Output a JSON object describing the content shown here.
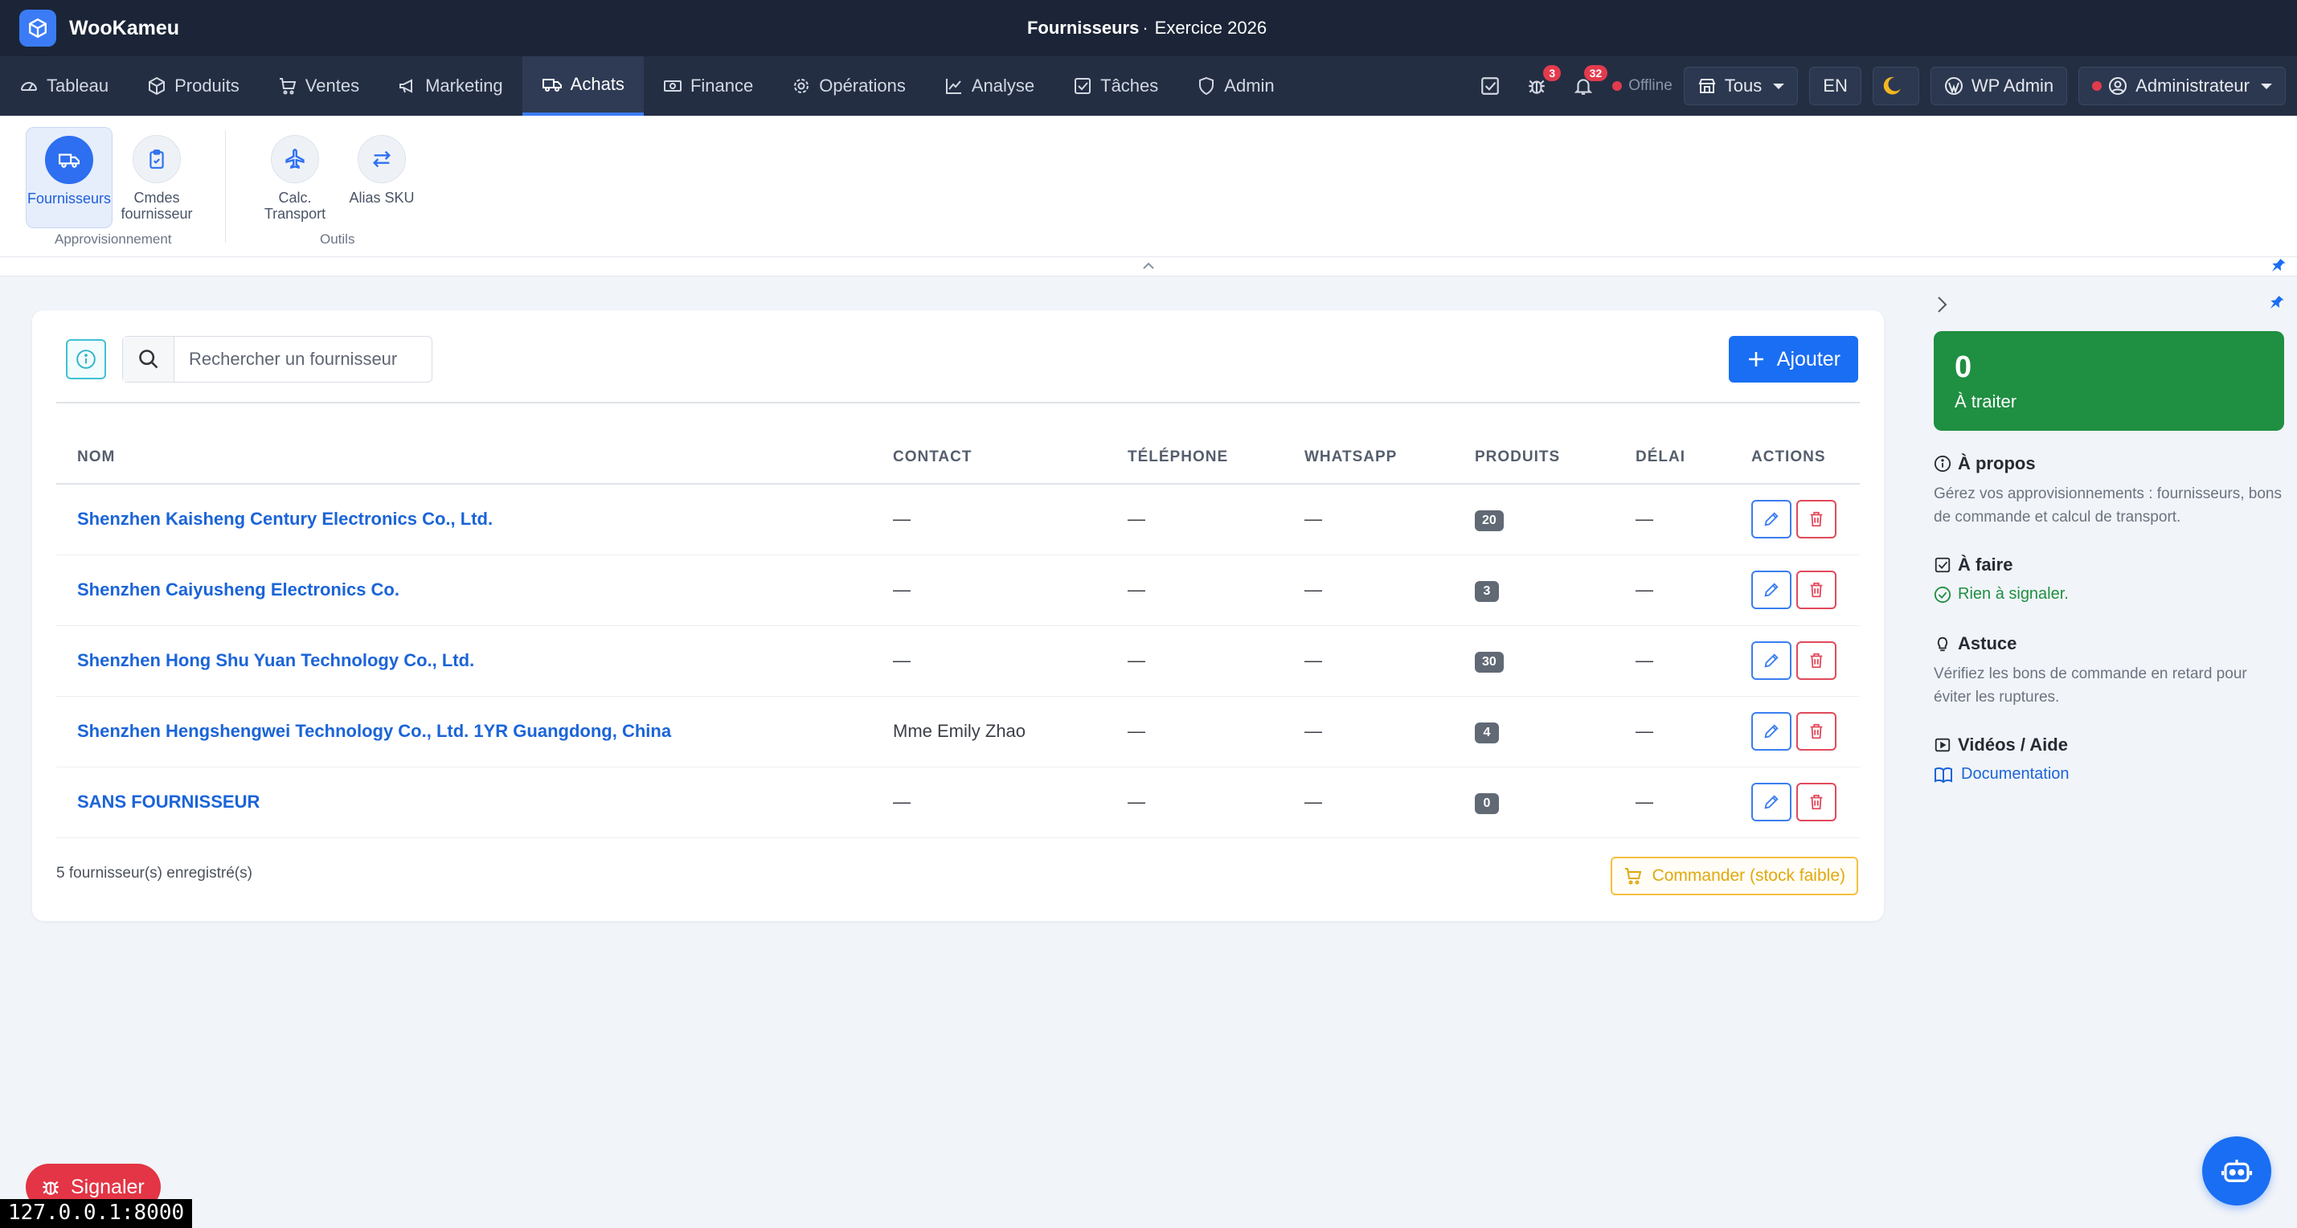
{
  "app": {
    "name": "WooKameu"
  },
  "heading": {
    "page": "Fournisseurs",
    "separator": "·",
    "year": "Exercice 2026"
  },
  "nav": {
    "items": [
      {
        "label": "Tableau",
        "icon": "gauge-icon"
      },
      {
        "label": "Produits",
        "icon": "box-icon"
      },
      {
        "label": "Ventes",
        "icon": "cart-icon"
      },
      {
        "label": "Marketing",
        "icon": "megaphone-icon"
      },
      {
        "label": "Achats",
        "icon": "truck-icon",
        "active": true
      },
      {
        "label": "Finance",
        "icon": "cash-icon"
      },
      {
        "label": "Opérations",
        "icon": "gear-icon"
      },
      {
        "label": "Analyse",
        "icon": "chart-icon"
      },
      {
        "label": "Tâches",
        "icon": "checkbox-icon"
      },
      {
        "label": "Admin",
        "icon": "shield-icon"
      }
    ],
    "bug_count": "3",
    "notif_count": "32",
    "offline": "Offline",
    "store": "Tous",
    "lang": "EN",
    "wp_admin": "WP Admin",
    "user": "Administrateur"
  },
  "ribbon": {
    "tiles": [
      {
        "label": "Fournisseurs"
      },
      {
        "label": "Cmdes fournisseur"
      },
      {
        "label": "Calc. Transport"
      },
      {
        "label": "Alias SKU"
      }
    ],
    "groups": [
      "Approvisionnement",
      "Outils"
    ]
  },
  "search": {
    "placeholder": "Rechercher un fournisseur"
  },
  "add_label": "Ajouter",
  "table": {
    "headers": [
      "NOM",
      "CONTACT",
      "TÉLÉPHONE",
      "WHATSAPP",
      "PRODUITS",
      "DÉLAI",
      "ACTIONS"
    ],
    "rows": [
      {
        "name": "Shenzhen Kaisheng Century Electronics Co., Ltd.",
        "contact": "—",
        "phone": "—",
        "whatsapp": "—",
        "products": "20",
        "delay": "—"
      },
      {
        "name": "Shenzhen Caiyusheng Electronics Co.",
        "contact": "—",
        "phone": "—",
        "whatsapp": "—",
        "products": "3",
        "delay": "—"
      },
      {
        "name": "Shenzhen Hong Shu Yuan Technology Co., Ltd.",
        "contact": "—",
        "phone": "—",
        "whatsapp": "—",
        "products": "30",
        "delay": "—"
      },
      {
        "name": "Shenzhen Hengshengwei Technology Co., Ltd. 1YR Guangdong, China",
        "contact": "Mme Emily Zhao",
        "phone": "—",
        "whatsapp": "—",
        "products": "4",
        "delay": "—"
      },
      {
        "name": "SANS FOURNISSEUR",
        "contact": "—",
        "phone": "—",
        "whatsapp": "—",
        "products": "0",
        "delay": "—"
      }
    ]
  },
  "footer": {
    "count": "5 fournisseur(s) enregistré(s)",
    "order_label": "Commander (stock faible)"
  },
  "side": {
    "stat_value": "0",
    "stat_label": "À traiter",
    "about_title": "À propos",
    "about_text": "Gérez vos approvisionnements : fournisseurs, bons de commande et calcul de transport.",
    "todo_title": "À faire",
    "todo_text": "Rien à signaler.",
    "tip_title": "Astuce",
    "tip_text": "Vérifiez les bons de commande en retard pour éviter les ruptures.",
    "video_title": "Vidéos / Aide",
    "doc_link": "Documentation"
  },
  "report_label": "Signaler",
  "url_tag": "127.0.0.1:8000",
  "colors": {
    "accent": "#1a6ef3",
    "nav_bg": "#232e43",
    "title_bg": "#1b2537",
    "success": "#1f8f41",
    "danger": "#e33545",
    "warning": "#f3c13e"
  }
}
